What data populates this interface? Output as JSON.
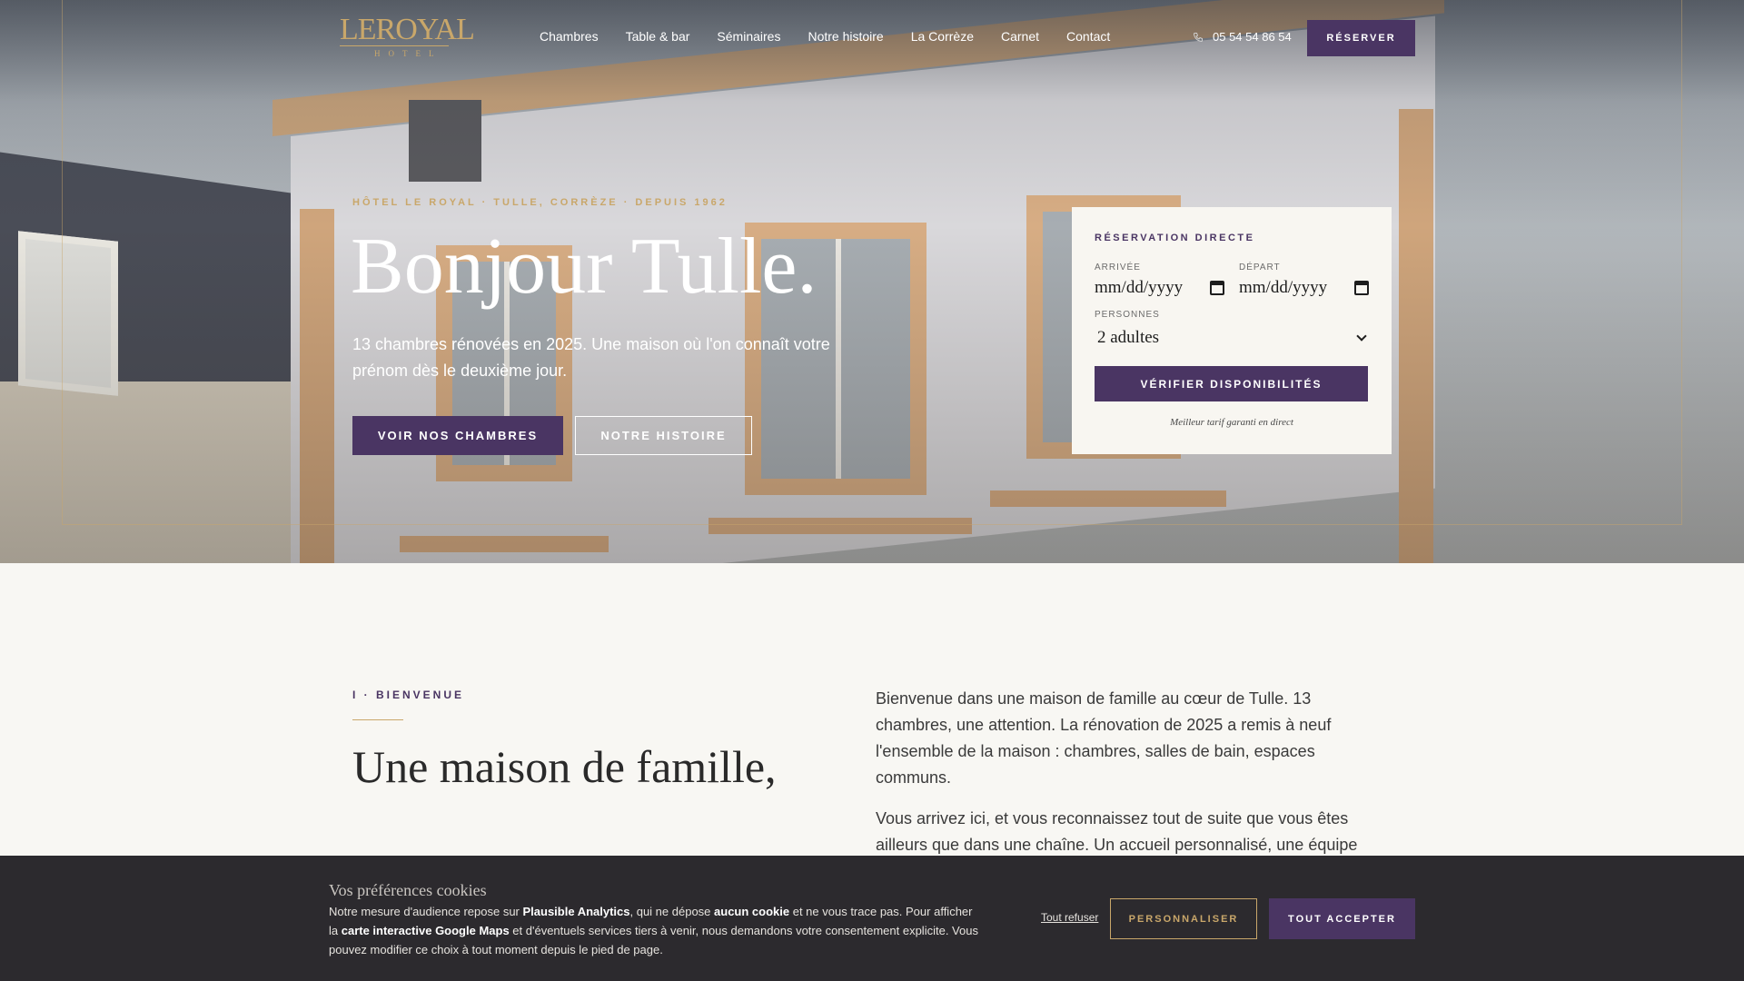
{
  "nav": {
    "logo_main": "LEROYAL",
    "logo_sub": "HOTEL",
    "items": [
      "Chambres",
      "Table & bar",
      "Séminaires",
      "Notre histoire",
      "La Corrèze",
      "Carnet",
      "Contact"
    ],
    "phone": "05 54 54 86 54",
    "reserve_label": "RÉSERVER"
  },
  "hero": {
    "kicker": "HÔTEL LE ROYAL · TULLE, CORRÈZE · DEPUIS 1962",
    "title": "Bonjour Tulle.",
    "subtitle": "13 chambres rénovées en 2025. Une maison où l'on connaît votre prénom dès le deuxième jour.",
    "primary_cta": "VOIR NOS CHAMBRES",
    "secondary_cta": "NOTRE HISTOIRE"
  },
  "booking": {
    "title": "RÉSERVATION DIRECTE",
    "arrival_label": "ARRIVÉE",
    "arrival_placeholder": "mm/dd/yyyy",
    "departure_label": "DÉPART",
    "departure_placeholder": "mm/dd/yyyy",
    "guests_label": "PERSONNES",
    "guests_value": "2 adultes",
    "verify_label": "VÉRIFIER DISPONIBILITÉS",
    "note": "Meilleur tarif garanti en direct"
  },
  "welcome": {
    "kicker": "I · BIENVENUE",
    "title": "Une maison de famille,",
    "para1": "Bienvenue dans une maison de famille au cœur de Tulle. 13 chambres, une attention. La rénovation de 2025 a remis à neuf l'ensemble de la maison : chambres, salles de bain, espaces communs.",
    "para2": "Vous arrivez ici, et vous reconnaissez tout de suite que vous êtes ailleurs que dans une chaîne. Un accueil personnalisé, une équipe"
  },
  "cookie": {
    "title": "Vos préférences cookies",
    "t1": "Notre mesure d'audience repose sur ",
    "b1": "Plausible Analytics",
    "t2": ", qui ne dépose ",
    "b2": "aucun cookie",
    "t3": " et ne vous trace pas. Pour afficher la ",
    "b3": "carte interactive Google Maps",
    "t4": " et d'éventuels services tiers à venir, nous demandons votre consentement explicite. Vous pouvez modifier ce choix à tout moment depuis le pied de page.",
    "refuse": "Tout refuser",
    "customize": "PERSONNALISER",
    "accept": "TOUT ACCEPTER"
  },
  "colors": {
    "brand_purple": "#4a3563",
    "gold": "#c9a76a",
    "cookie_bg": "#2c2a2e"
  }
}
